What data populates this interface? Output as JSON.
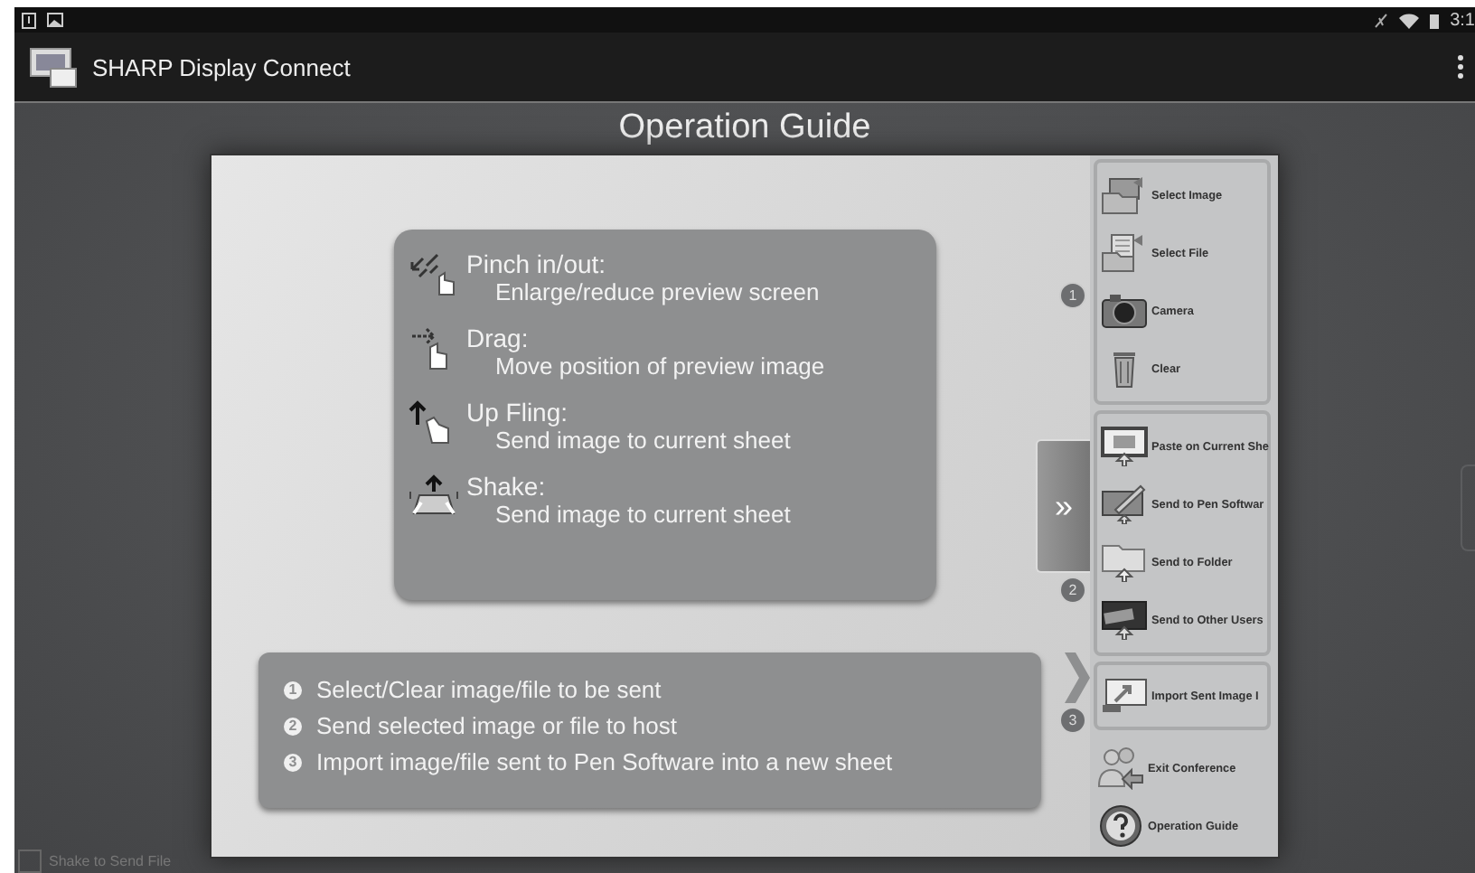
{
  "status_bar": {
    "time": "3:1"
  },
  "app_bar": {
    "title": "SHARP Display Connect"
  },
  "guide": {
    "title": "Operation Guide",
    "gestures": [
      {
        "kind": "pinch",
        "name": "Pinch in/out:",
        "description": "Enlarge/reduce preview screen"
      },
      {
        "kind": "drag",
        "name": "Drag:",
        "description": "Move position of preview image"
      },
      {
        "kind": "fling",
        "name": "Up Fling:",
        "description": "Send image to current sheet"
      },
      {
        "kind": "shake",
        "name": "Shake:",
        "description": "Send image to current sheet"
      }
    ],
    "steps": [
      {
        "number": "1",
        "text": "Select/Clear image/file to be sent"
      },
      {
        "number": "2",
        "text": "Send selected image or file to host"
      },
      {
        "number": "3",
        "text": "Import image/file sent to Pen Software into a new sheet"
      }
    ],
    "expand_tab": {
      "label": "»"
    }
  },
  "sidebar": {
    "groups": [
      {
        "marker": "1",
        "items": [
          {
            "kind": "image",
            "label": "Select Image"
          },
          {
            "kind": "file",
            "label": "Select File"
          },
          {
            "kind": "camera",
            "label": "Camera"
          },
          {
            "kind": "trash",
            "label": "Clear"
          }
        ]
      },
      {
        "marker": "2",
        "items": [
          {
            "kind": "monitor",
            "label": "Paste on Current She"
          },
          {
            "kind": "pen",
            "label": "Send to Pen Softwar"
          },
          {
            "kind": "folder",
            "label": "Send to Folder"
          },
          {
            "kind": "quick",
            "label": "Send to Other Users"
          }
        ]
      },
      {
        "marker": "3",
        "items": [
          {
            "kind": "import",
            "label": "Import Sent Image I"
          }
        ]
      },
      {
        "items": [
          {
            "kind": "users",
            "label": "Exit Conference"
          },
          {
            "kind": "help",
            "label": "Operation Guide"
          }
        ]
      }
    ]
  },
  "shake_option": {
    "label": "Shake to Send File",
    "checked": false
  }
}
